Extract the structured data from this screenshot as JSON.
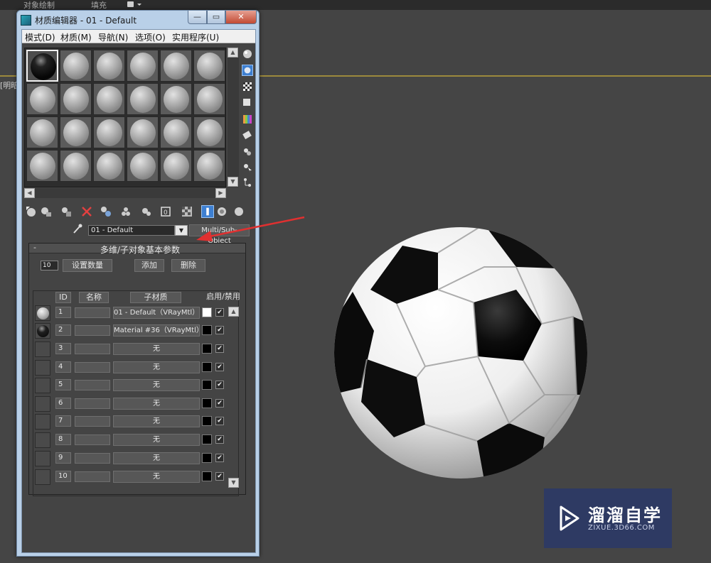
{
  "app": {
    "top_tabs": [
      "对象绘制",
      "填充"
    ],
    "viewport_label": "[明暗"
  },
  "material_editor": {
    "title": "材质编辑器 - 01 - Default",
    "window_buttons": {
      "minimize": "—",
      "maximize": "▭",
      "close": "✕"
    },
    "menu": [
      "模式(D)",
      "材质(M)",
      "导航(N)",
      "选项(O)",
      "实用程序(U)"
    ],
    "slots": {
      "rows": 4,
      "cols": 6,
      "selected_index": 0,
      "selected_material": "black"
    },
    "material_name": "01 - Default",
    "material_type": "Multi/Sub-Object",
    "rollout": {
      "title": "多维/子对象基本参数",
      "collapse": "-",
      "count": "10",
      "set_count_button": "设置数量",
      "add_button": "添加",
      "delete_button": "删除",
      "headers": {
        "id": "ID",
        "name": "名称",
        "sub": "子材质",
        "enable": "启用/禁用"
      },
      "rows": [
        {
          "id": "1",
          "sub": "01 - Default（VRayMtl）",
          "color": "white",
          "preview": "white",
          "checked": "✔"
        },
        {
          "id": "2",
          "sub": "Material #36（VRayMtl）",
          "color": "black",
          "preview": "black",
          "checked": "✔"
        },
        {
          "id": "3",
          "sub": "无",
          "color": "black",
          "preview": "",
          "checked": "✔"
        },
        {
          "id": "4",
          "sub": "无",
          "color": "black",
          "preview": "",
          "checked": "✔"
        },
        {
          "id": "5",
          "sub": "无",
          "color": "black",
          "preview": "",
          "checked": "✔"
        },
        {
          "id": "6",
          "sub": "无",
          "color": "black",
          "preview": "",
          "checked": "✔"
        },
        {
          "id": "7",
          "sub": "无",
          "color": "black",
          "preview": "",
          "checked": "✔"
        },
        {
          "id": "8",
          "sub": "无",
          "color": "black",
          "preview": "",
          "checked": "✔"
        },
        {
          "id": "9",
          "sub": "无",
          "color": "black",
          "preview": "",
          "checked": "✔"
        },
        {
          "id": "10",
          "sub": "无",
          "color": "black",
          "preview": "",
          "checked": "✔"
        }
      ]
    },
    "side_tools": [
      "sample-type-icon",
      "backlight-icon",
      "background-icon",
      "uv-tiling-icon",
      "video-color-check-icon",
      "make-preview-icon",
      "options-icon",
      "select-by-material-icon",
      "material-navigator-icon"
    ],
    "bottom_tools": [
      "get-material-icon",
      "put-to-scene-icon",
      "assign-material-icon",
      "reset-map-icon",
      "make-unique-icon",
      "put-to-library-icon",
      "material-id-channel-icon",
      "show-map-icon",
      "show-end-result-icon",
      "go-to-parent-icon",
      "go-forward-icon",
      "go-to-sibling-icon"
    ]
  },
  "watermark": {
    "title": "溜溜自学",
    "subtitle": "ZIXUE.3D66.COM"
  },
  "colors": {
    "viewport_bg": "#454545",
    "window_frame": "#b9d0e8",
    "panel_bg": "#444444",
    "accent_blue": "#3d7fd1",
    "annotation_red": "#e03030",
    "watermark_bg": "#2e3a63"
  }
}
